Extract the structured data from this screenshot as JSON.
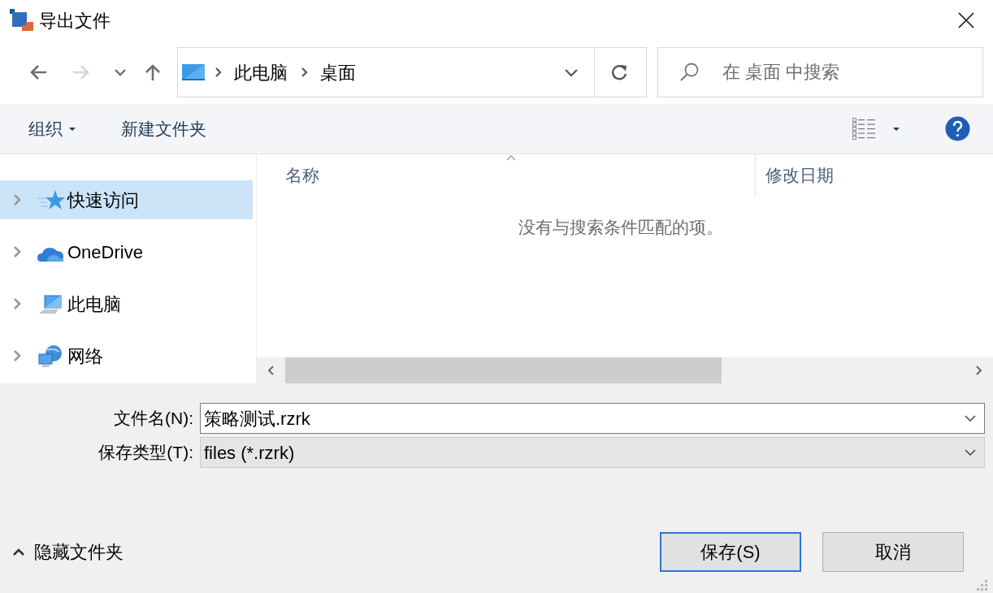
{
  "window": {
    "title": "导出文件"
  },
  "nav": [
    {
      "kind": "back",
      "disabled": false
    },
    {
      "kind": "forward",
      "disabled": true
    },
    {
      "kind": "recent",
      "disabled": false
    },
    {
      "kind": "up",
      "disabled": false
    }
  ],
  "address": {
    "crumbs": [
      "此电脑",
      "桌面"
    ]
  },
  "search": {
    "placeholder": "在 桌面 中搜索"
  },
  "toolbar": {
    "organize": "组织",
    "new_folder": "新建文件夹"
  },
  "sidebar": {
    "items": [
      {
        "label": "快速访问",
        "kind": "star",
        "selected": true
      },
      {
        "label": "OneDrive",
        "kind": "cloud",
        "selected": false
      },
      {
        "label": "此电脑",
        "kind": "computer",
        "selected": false
      },
      {
        "label": "网络",
        "kind": "network",
        "selected": false
      }
    ]
  },
  "table": {
    "columns": [
      {
        "label": "名称",
        "sorted": true
      },
      {
        "label": "修改日期",
        "sorted": false
      }
    ],
    "empty_message": "没有与搜索条件匹配的项。"
  },
  "form": {
    "filename_label": "文件名(N):",
    "filename": "策略测试.rzrk",
    "type_label": "保存类型(T):",
    "type": "files (*.rzrk)"
  },
  "hide_folders": "隐藏文件夹",
  "buttons": [
    {
      "label": "保存(S)",
      "default": true
    },
    {
      "label": "取消",
      "default": false
    }
  ]
}
